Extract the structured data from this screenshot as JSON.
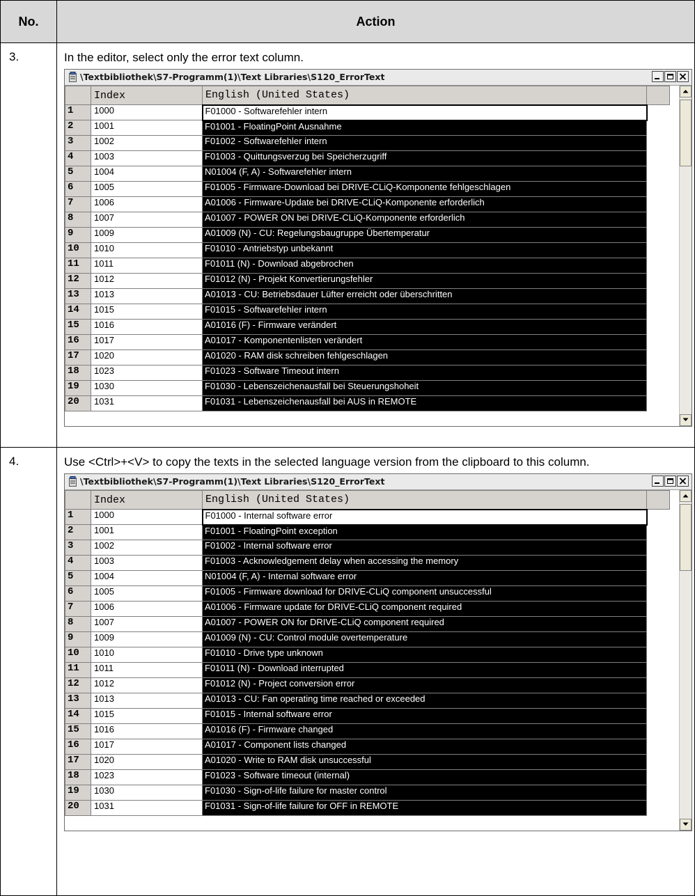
{
  "table": {
    "header_no": "No.",
    "header_action": "Action"
  },
  "steps": [
    {
      "number": "3.",
      "text": "In the editor, select only the error text column.",
      "window": {
        "title": "\\Textbibliothek\\S7-Programm(1)\\Text Libraries\\S120_ErrorText",
        "col_index": "Index",
        "col_text": "English (United States)",
        "rows": [
          [
            "1",
            "1000",
            "F01000 - Softwarefehler intern"
          ],
          [
            "2",
            "1001",
            "F01001 - FloatingPoint Ausnahme"
          ],
          [
            "3",
            "1002",
            "F01002 - Softwarefehler intern"
          ],
          [
            "4",
            "1003",
            "F01003 - Quittungsverzug bei Speicherzugriff"
          ],
          [
            "5",
            "1004",
            "N01004 (F, A) - Softwarefehler intern"
          ],
          [
            "6",
            "1005",
            "F01005 - Firmware-Download bei DRIVE-CLiQ-Komponente fehlgeschlagen"
          ],
          [
            "7",
            "1006",
            "A01006 - Firmware-Update bei DRIVE-CLiQ-Komponente erforderlich"
          ],
          [
            "8",
            "1007",
            "A01007 - POWER ON bei DRIVE-CLiQ-Komponente erforderlich"
          ],
          [
            "9",
            "1009",
            "A01009 (N) - CU: Regelungsbaugruppe Übertemperatur"
          ],
          [
            "10",
            "1010",
            "F01010 - Antriebstyp unbekannt"
          ],
          [
            "11",
            "1011",
            "F01011 (N) - Download abgebrochen"
          ],
          [
            "12",
            "1012",
            "F01012 (N) - Projekt Konvertierungsfehler"
          ],
          [
            "13",
            "1013",
            "A01013 - CU: Betriebsdauer Lüfter erreicht oder überschritten"
          ],
          [
            "14",
            "1015",
            "F01015 - Softwarefehler intern"
          ],
          [
            "15",
            "1016",
            "A01016 (F) - Firmware verändert"
          ],
          [
            "16",
            "1017",
            "A01017 - Komponentenlisten verändert"
          ],
          [
            "17",
            "1020",
            "A01020 - RAM disk schreiben fehlgeschlagen"
          ],
          [
            "18",
            "1023",
            "F01023 - Software Timeout intern"
          ],
          [
            "19",
            "1030",
            "F01030 - Lebenszeichenausfall bei Steuerungshoheit"
          ],
          [
            "20",
            "1031",
            "F01031 - Lebenszeichenausfall bei AUS in REMOTE"
          ]
        ]
      }
    },
    {
      "number": "4.",
      "text": "Use <Ctrl>+<V> to copy the texts in the selected language version from the clipboard to this column.",
      "window": {
        "title": "\\Textbibliothek\\S7-Programm(1)\\Text Libraries\\S120_ErrorText",
        "col_index": "Index",
        "col_text": "English (United States)",
        "rows": [
          [
            "1",
            "1000",
            "F01000 - Internal software error"
          ],
          [
            "2",
            "1001",
            "F01001 - FloatingPoint exception"
          ],
          [
            "3",
            "1002",
            "F01002 - Internal software error"
          ],
          [
            "4",
            "1003",
            "F01003 - Acknowledgement delay when accessing the memory"
          ],
          [
            "5",
            "1004",
            "N01004 (F, A) - Internal software error"
          ],
          [
            "6",
            "1005",
            "F01005 - Firmware download for DRIVE-CLiQ component unsuccessful"
          ],
          [
            "7",
            "1006",
            "A01006 - Firmware update for DRIVE-CLiQ component required"
          ],
          [
            "8",
            "1007",
            "A01007 - POWER ON for DRIVE-CLiQ component required"
          ],
          [
            "9",
            "1009",
            "A01009 (N) - CU: Control module overtemperature"
          ],
          [
            "10",
            "1010",
            "F01010 - Drive type unknown"
          ],
          [
            "11",
            "1011",
            "F01011 (N) - Download interrupted"
          ],
          [
            "12",
            "1012",
            "F01012 (N) - Project conversion error"
          ],
          [
            "13",
            "1013",
            "A01013 - CU: Fan operating time reached or exceeded"
          ],
          [
            "14",
            "1015",
            "F01015 - Internal software error"
          ],
          [
            "15",
            "1016",
            "A01016 (F) - Firmware changed"
          ],
          [
            "16",
            "1017",
            "A01017 - Component lists changed"
          ],
          [
            "17",
            "1020",
            "A01020 - Write to RAM disk unsuccessful"
          ],
          [
            "18",
            "1023",
            "F01023 - Software timeout (internal)"
          ],
          [
            "19",
            "1030",
            "F01030 - Sign-of-life failure for master control"
          ],
          [
            "20",
            "1031",
            "F01031 - Sign-of-life failure for OFF in REMOTE"
          ]
        ]
      }
    }
  ]
}
